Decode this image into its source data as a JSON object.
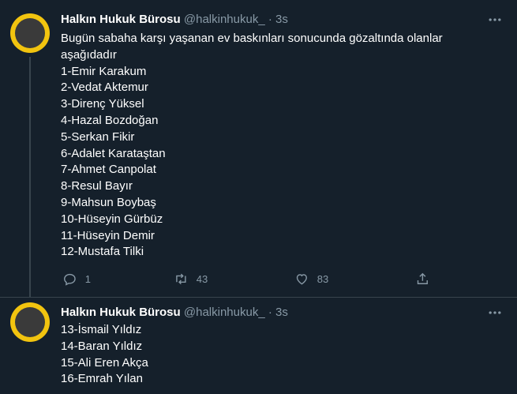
{
  "tweets": [
    {
      "name": "Halkın Hukuk Bürosu",
      "handle": "@halkinhukuk_",
      "separator": "·",
      "time": "3s",
      "lines": [
        "Bugün sabaha karşı yaşanan ev baskınları sonucunda gözaltında olanlar",
        "aşağıdadır",
        "1-Emir Karakum",
        "2-Vedat Aktemur",
        "3-Direnç Yüksel",
        "4-Hazal Bozdoğan",
        "5-Serkan Fikir",
        "6-Adalet Karataştan",
        "7-Ahmet Canpolat",
        "8-Resul Bayır",
        "9-Mahsun Boybaş",
        "10-Hüseyin Gürbüz",
        "11-Hüseyin Demir",
        "12-Mustafa Tilki"
      ],
      "replies": "1",
      "retweets": "43",
      "likes": "83"
    },
    {
      "name": "Halkın Hukuk Bürosu",
      "handle": "@halkinhukuk_",
      "separator": "·",
      "time": "3s",
      "lines": [
        "13-İsmail Yıldız",
        "14-Baran Yıldız",
        "15-Ali Eren Akça",
        "16-Emrah Yılan"
      ]
    }
  ],
  "icons": {
    "more": "more-horizontal-icon",
    "reply": "reply-icon",
    "retweet": "retweet-icon",
    "like": "heart-icon",
    "share": "share-icon"
  },
  "colors": {
    "background": "#15202b",
    "secondary_text": "#8899a6",
    "divider": "#38444d",
    "avatar_ring": "#f2c40f"
  }
}
